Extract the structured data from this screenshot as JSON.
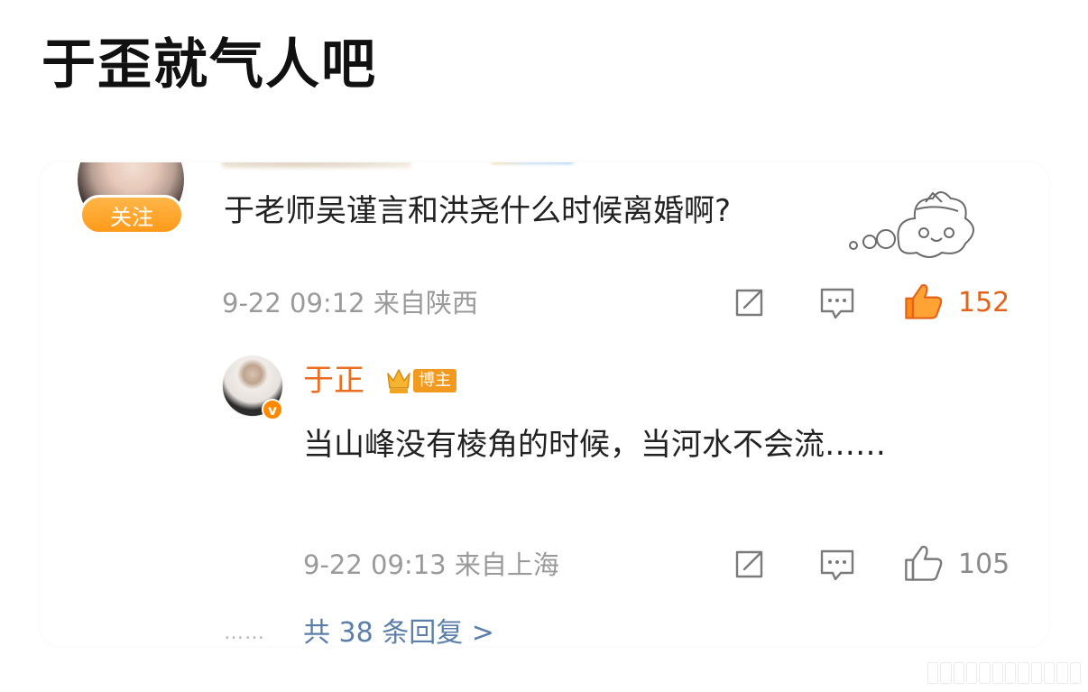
{
  "post": {
    "title": "于歪就气人吧"
  },
  "comment": {
    "follow_label": "关注",
    "text": "于老师吴谨言和洪尧什么时候离婚啊?",
    "meta": "9-22 09:12 来自陕西",
    "like_count": "152",
    "liked": true
  },
  "reply": {
    "author": "于正",
    "badge": "博主",
    "text": "当山峰没有棱角的时候，当河水不会流……",
    "meta": "9-22 09:13 来自上海",
    "like_count": "105",
    "liked": false
  },
  "more_replies": {
    "label": "共 38 条回复 >"
  },
  "colors": {
    "accent_orange": "#ea6d22",
    "follow_button": "#ff9a1a",
    "link_blue": "#5b7fa8",
    "meta_gray": "#9a9a9a"
  },
  "icons": [
    "share-icon",
    "comment-icon",
    "thumbs-up-icon",
    "crown-icon",
    "verified-icon",
    "sticker-icon"
  ]
}
